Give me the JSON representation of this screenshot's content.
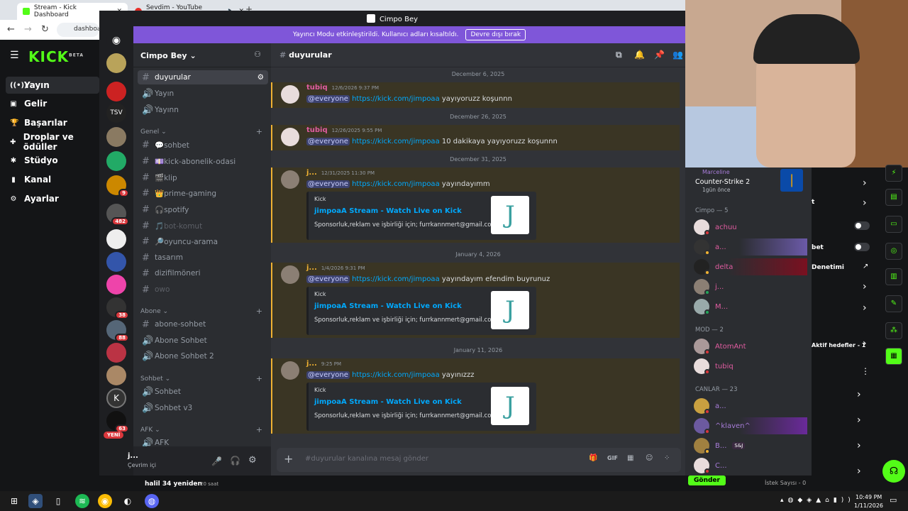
{
  "browser": {
    "tab1": "Stream - Kick Dashboard",
    "tab2": "Sevdim - YouTube Music",
    "url": "dashboa"
  },
  "kick": {
    "logo": "KICK",
    "logo_sup": "BETA",
    "menu": [
      "Yayın",
      "Gelir",
      "Başarılar",
      "Droplar ve ödüller",
      "Stüdyo",
      "Kanal",
      "Ayarlar"
    ]
  },
  "discord": {
    "window_title": "Cimpo Bey",
    "streamer_notice": "Yayıncı Modu etkinleştirildi. Kullanıcı adları kısaltıldı.",
    "streamer_disable": "Devre dışı bırak",
    "server_name": "Cimpo Bey",
    "new_badge": "YENİ",
    "server_badges": [
      "9",
      "482",
      "38",
      "88",
      "63"
    ],
    "channels_top": [
      {
        "label": "duyurular",
        "type": "text"
      },
      {
        "label": "Yayın",
        "type": "voice"
      },
      {
        "label": "Yayınn",
        "type": "voice"
      }
    ],
    "categories": [
      "Genel",
      "Abone",
      "Sohbet",
      "AFK"
    ],
    "channels_genel": [
      "💬sohbet",
      "💷kick-abonelik-odasi",
      "🎬klip",
      "👑prime-gaming",
      "🎧spotify",
      "🎵bot-komut",
      "🔎oyuncu-arama",
      "tasarım",
      "dizifilmöneri",
      "owo"
    ],
    "channels_abone": [
      "abone-sohbet",
      "Abone Sohbet",
      "Abone Sohbet 2"
    ],
    "channels_sohbet": [
      "Sohbet",
      "Sohbet v3"
    ],
    "channels_afk": [
      "AFK"
    ],
    "user": {
      "name": "j...",
      "status": "Çevrim içi"
    },
    "chat_channel": "duyurular",
    "composer_placeholder": "#duyurular kanalına mesaj gönder",
    "dates": [
      "December 6, 2025",
      "December 26, 2025",
      "December 31, 2025",
      "January 4, 2026",
      "January 11, 2026"
    ],
    "messages": [
      {
        "author": "tubiq",
        "time": "12/6/2026 9:37 PM",
        "mention": "@everyone",
        "link": "https://kick.com/jimpoaa",
        "text": "yayıyoruzz koşunnn"
      },
      {
        "author": "tubiq",
        "time": "12/26/2025 9:55 PM",
        "mention": "@everyone",
        "link": "https://kick.com/jimpoaa",
        "text": "10 dakikaya yayıyoruzz koşunnn"
      },
      {
        "author": "j...",
        "time": "12/31/2025 11:30 PM",
        "mention": "@everyone",
        "link": "https://kick.com/jimpoaa",
        "text": "yayındayımm"
      },
      {
        "author": "j...",
        "time": "1/4/2026 9:31 PM",
        "mention": "@everyone",
        "link": "https://kick.com/jimpoaa",
        "text": "yayındayım efendim buyrunuz"
      },
      {
        "author": "j...",
        "time": "9:25 PM",
        "mention": "@everyone",
        "link": "https://kick.com/jimpoaa",
        "text": "yayınızzz"
      }
    ],
    "embed": {
      "provider": "Kick",
      "title": "jimpoaA Stream - Watch Live on Kick",
      "description": "Sponsorluk,reklam ve işbirliği için; furrkannmert@gmail.com",
      "thumb": "J"
    },
    "members": {
      "activity_user": "Marceline",
      "activity_game": "Counter-Strike 2",
      "activity_time": "1gün önce",
      "group1": "Cimpo — 5",
      "group1_members": [
        "achuu",
        "a...",
        "delta",
        "j...",
        "M..."
      ],
      "group2": "MOD — 2",
      "group2_members": [
        "AtomAnt",
        "tubiq"
      ],
      "group3": "CANLAR — 23",
      "group3_members": [
        "a...",
        "^klaven^",
        "B...",
        "C..."
      ],
      "tag": "S&J"
    }
  },
  "kick_right": {
    "row_t": "t",
    "row_bet": "bet",
    "row_denetimi": "Denetimi",
    "row_goals": "Aktif hedefler - 1",
    "bottom_btn": "Gönder",
    "bottom_req": "İstek Sayısı - 0"
  },
  "taskbar": {
    "time": "10:49 PM",
    "date": "1/11/2026",
    "behind_text": "halil  34 yeniden",
    "behind_time": "20 saat"
  },
  "colors": {
    "kick_green": "#53fc18",
    "discord_purple": "#7f56d9",
    "mention_highlight": "#f0b232",
    "link": "#00a8fc"
  }
}
